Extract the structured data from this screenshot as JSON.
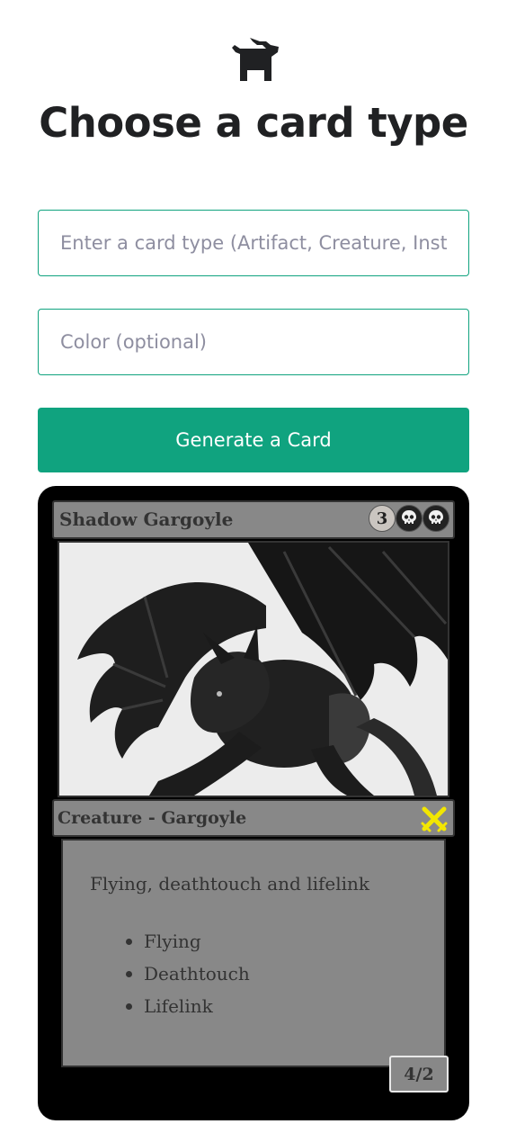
{
  "header": {
    "logo_icon": "dog-icon",
    "title": "Choose a card type"
  },
  "form": {
    "card_type": {
      "value": "",
      "placeholder": "Enter a card type (Artifact, Creature, Instant, Land, Sorcery, Enchantment)"
    },
    "color": {
      "value": "",
      "placeholder": "Color (optional)"
    },
    "generate_label": "Generate a Card",
    "accent_color": "#10a37f"
  },
  "card": {
    "name": "Shadow Gargoyle",
    "mana_cost": {
      "generic": "3",
      "symbols": [
        "black-skull-icon",
        "black-skull-icon"
      ]
    },
    "art_icon": "shadow-gargoyle-illustration",
    "type_line": "Creature - Gargoyle",
    "set_icon": "crossed-swords-icon",
    "set_color": "#f2e600",
    "rules_text": "Flying, deathtouch and lifelink",
    "abilities": [
      "Flying",
      "Deathtouch",
      "Lifelink"
    ],
    "power_toughness": "4/2",
    "frame_color": "#888888"
  }
}
